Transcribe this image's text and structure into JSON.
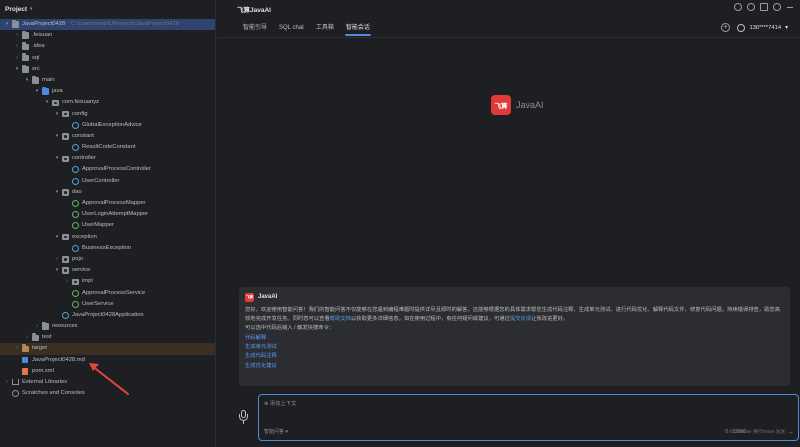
{
  "project": {
    "title": "Project",
    "tree": [
      {
        "label": "JavaProject0428",
        "path": "C:\\Users\\xwtp\\IJProjects\\JavaProject0428",
        "indent": 0,
        "arrow": "▾",
        "icon": "folder-icon",
        "icls": "folder",
        "sel": true
      },
      {
        "label": ".feisuan",
        "indent": 1,
        "arrow": "›",
        "icon": "folder-icon",
        "icls": "folder"
      },
      {
        "label": ".idea",
        "indent": 1,
        "arrow": "›",
        "icon": "folder-icon",
        "icls": "folder"
      },
      {
        "label": "sql",
        "indent": 1,
        "arrow": "›",
        "icon": "folder-icon",
        "icls": "folder"
      },
      {
        "label": "src",
        "indent": 1,
        "arrow": "▾",
        "icon": "folder-icon",
        "icls": "folder"
      },
      {
        "label": "main",
        "indent": 2,
        "arrow": "▾",
        "icon": "folder-icon",
        "icls": "folder"
      },
      {
        "label": "java",
        "indent": 3,
        "arrow": "▾",
        "icon": "source-folder-icon",
        "icls": "folder blue"
      },
      {
        "label": "com.feisuanyz",
        "indent": 4,
        "arrow": "▾",
        "icon": "package-icon",
        "icls": "pkg"
      },
      {
        "label": "config",
        "indent": 5,
        "arrow": "▾",
        "icon": "package-icon",
        "icls": "pkg"
      },
      {
        "label": "GlobalExceptionAdvice",
        "indent": 6,
        "arrow": "",
        "icon": "class-icon",
        "icls": "cls"
      },
      {
        "label": "constant",
        "indent": 5,
        "arrow": "▾",
        "icon": "package-icon",
        "icls": "pkg"
      },
      {
        "label": "ResultCodeConstant",
        "indent": 6,
        "arrow": "",
        "icon": "class-icon",
        "icls": "cls"
      },
      {
        "label": "controller",
        "indent": 5,
        "arrow": "▾",
        "icon": "package-icon",
        "icls": "pkg"
      },
      {
        "label": "ApprovalProcessController",
        "indent": 6,
        "arrow": "",
        "icon": "class-icon",
        "icls": "cls"
      },
      {
        "label": "UserController",
        "indent": 6,
        "arrow": "",
        "icon": "class-icon",
        "icls": "cls"
      },
      {
        "label": "dao",
        "indent": 5,
        "arrow": "▾",
        "icon": "package-icon",
        "icls": "pkg"
      },
      {
        "label": "ApprovalProcessMapper",
        "indent": 6,
        "arrow": "",
        "icon": "interface-icon",
        "icls": "intf"
      },
      {
        "label": "UserLoginAttemptMapper",
        "indent": 6,
        "arrow": "",
        "icon": "interface-icon",
        "icls": "intf"
      },
      {
        "label": "UserMapper",
        "indent": 6,
        "arrow": "",
        "icon": "interface-icon",
        "icls": "intf"
      },
      {
        "label": "exception",
        "indent": 5,
        "arrow": "▾",
        "icon": "package-icon",
        "icls": "pkg"
      },
      {
        "label": "BusinessException",
        "indent": 6,
        "arrow": "",
        "icon": "class-icon",
        "icls": "cls"
      },
      {
        "label": "pojo",
        "indent": 5,
        "arrow": "›",
        "icon": "package-icon",
        "icls": "pkg"
      },
      {
        "label": "service",
        "indent": 5,
        "arrow": "▾",
        "icon": "package-icon",
        "icls": "pkg"
      },
      {
        "label": "impl",
        "indent": 6,
        "arrow": "›",
        "icon": "package-icon",
        "icls": "pkg"
      },
      {
        "label": "ApprovalProcessService",
        "indent": 6,
        "arrow": "",
        "icon": "interface-icon",
        "icls": "intf"
      },
      {
        "label": "UserService",
        "indent": 6,
        "arrow": "",
        "icon": "interface-icon",
        "icls": "intf"
      },
      {
        "label": "JavaProject0428Application",
        "indent": 5,
        "arrow": "",
        "icon": "class-icon",
        "icls": "cls"
      },
      {
        "label": "resources",
        "indent": 3,
        "arrow": "›",
        "icon": "folder-icon",
        "icls": "folder"
      },
      {
        "label": "test",
        "indent": 2,
        "arrow": "›",
        "icon": "folder-icon",
        "icls": "folder"
      },
      {
        "label": "target",
        "indent": 1,
        "arrow": "›",
        "icon": "excluded-folder-icon",
        "icls": "folder orange",
        "excl": true
      },
      {
        "label": "JavaProject0428.md",
        "indent": 1,
        "arrow": "",
        "icon": "markdown-file-icon",
        "icls": "md"
      },
      {
        "label": "pom.xml",
        "indent": 1,
        "arrow": "",
        "icon": "maven-file-icon",
        "icls": "xml"
      },
      {
        "label": "External Libraries",
        "indent": 0,
        "arrow": "›",
        "icon": "library-icon",
        "icls": "lib"
      },
      {
        "label": "Scratches and Consoles",
        "indent": 0,
        "arrow": "",
        "icon": "scratch-icon",
        "icls": "scr"
      }
    ]
  },
  "ai": {
    "title": "飞算JavaAI",
    "tabs": [
      "智能引导",
      "SQL chat",
      "工具箱",
      "智能会话"
    ],
    "active_tab": 3,
    "account": "130****7414",
    "logo_mark": "飞算",
    "logo_text": "JavaAI",
    "message": {
      "name": "JavaAI",
      "mark": "飞算",
      "text_before_link1": "您好，欢迎使用智能问答！我们的智能问答不仅能够在您遇到编程难题时提供详尽且即时的解答，还能够根据您的具体需求帮您生成代码注释、生成单元测试、进行代码优化、解释代码文件、修复代码问题。持续错误排查，助您高效地完成开发任务。同时您可以查看",
      "link1": "帮助文档",
      "text_between": "以获取更多详细信息。如在使用过程中，有任何疑问或建议，可通过",
      "link2": "提交反馈",
      "text_after": "让我改进更好。",
      "line2": "可以选中代码后输入 / 触发快捷命令：",
      "quick_links": [
        "代码解释",
        "生成单元测试",
        "生成代码注释",
        "生成优化建议"
      ]
    },
    "input": {
      "context_button": "⊕ 添加上下文",
      "mode": "智能问答 ▾",
      "count": "0 / 12000",
      "hint": "Ctrl+Enter 换行/Enter 发送",
      "send": "→"
    }
  }
}
